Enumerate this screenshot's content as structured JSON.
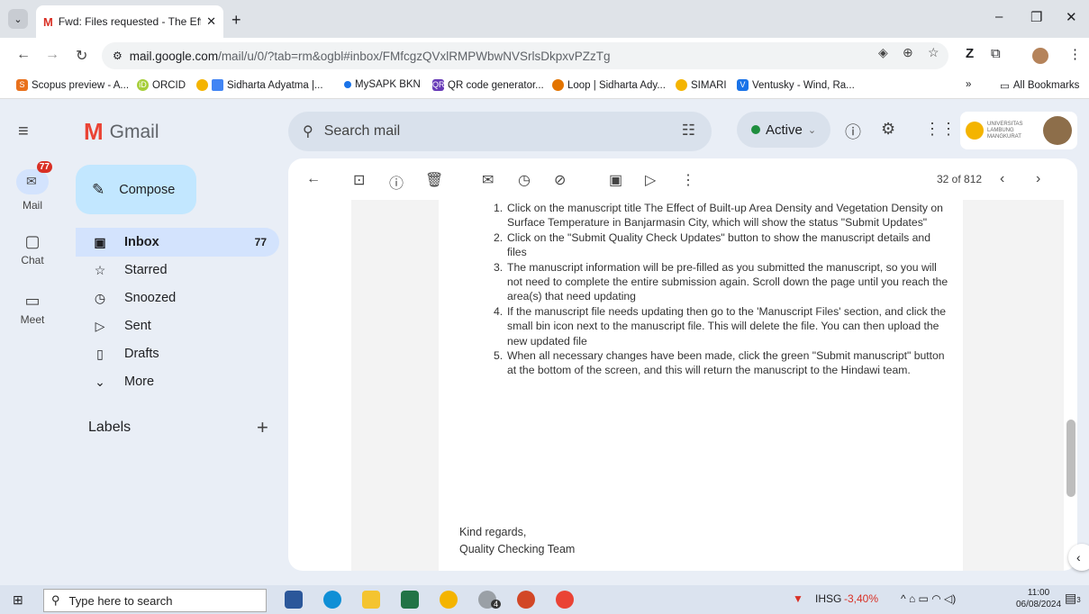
{
  "browser": {
    "tab_title": "Fwd: Files requested - The Effec",
    "url_host": "mail.google.com",
    "url_path": "/mail/u/0/?tab=rm&ogbl#inbox/FMfcgzQVxlRMPWbwNVSrlsDkpxvPZzTg",
    "bookmarks": [
      "Scopus preview - A...",
      "ORCID",
      "Sidharta Adyatma |...",
      "MySAPK BKN",
      "QR code generator...",
      "Loop | Sidharta Ady...",
      "SIMARI",
      "Ventusky - Wind, Ra..."
    ],
    "all_bookmarks": "All Bookmarks",
    "more_bookmarks": "»"
  },
  "gmail": {
    "logo_text": "Gmail",
    "search_placeholder": "Search mail",
    "status": "Active",
    "account_org": "UNIVERSITAS LAMBUNG MANGKURAT"
  },
  "rail": {
    "mail": "Mail",
    "mail_badge": "77",
    "chat": "Chat",
    "meet": "Meet"
  },
  "nav": {
    "compose": "Compose",
    "inbox": "Inbox",
    "inbox_count": "77",
    "starred": "Starred",
    "snoozed": "Snoozed",
    "sent": "Sent",
    "drafts": "Drafts",
    "more": "More",
    "labels": "Labels"
  },
  "toolbar": {
    "pager": "32 of 812"
  },
  "message": {
    "steps": [
      {
        "n": "1.",
        "text": "Click on the manuscript title The Effect of Built-up Area Density and Vegetation Density on Surface Temperature in Banjarmasin City, which will show the status \"Submit Updates\""
      },
      {
        "n": "2.",
        "text": "Click on the \"Submit Quality Check Updates\" button to show the manuscript details and files"
      },
      {
        "n": "3.",
        "text": "The manuscript information will be pre-filled as you submitted the manuscript, so you will not need to complete the entire submission again. Scroll down the page until you reach the area(s) that need updating"
      },
      {
        "n": "4.",
        "text": "If the manuscript file needs updating then go to the 'Manuscript Files' section, and click the small bin icon next to the manuscript file. This will delete the file. You can then upload the new updated file"
      },
      {
        "n": "5.",
        "text": "When all necessary changes have been made, click the green \"Submit manuscript\" button at the bottom of the screen, and this will return the manuscript to the Hindawi team."
      }
    ],
    "closing": "Kind regards,",
    "signature": "Quality Checking Team"
  },
  "taskbar": {
    "search_placeholder": "Type here to search",
    "whatsapp_badge": "4",
    "stock_name": "IHSG",
    "stock_change": "-3,40%",
    "time": "11:00",
    "date": "06/08/2024",
    "notif_count": "3"
  },
  "colors": {
    "gmail_red": "#ea4335",
    "compose_bg": "#c2e7ff",
    "active_green": "#1e8e3e",
    "stock_down": "#d93025"
  }
}
